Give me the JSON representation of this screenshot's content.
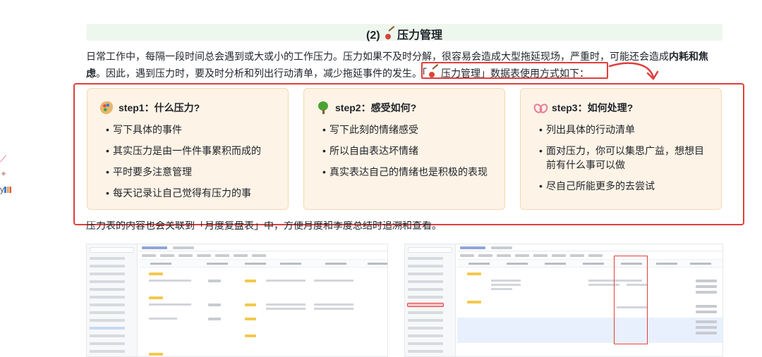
{
  "sidebar_fragment": {
    "items": [
      "",
      "",
      "y"
    ]
  },
  "heading": {
    "prefix": "(2)",
    "title": "压力管理"
  },
  "paragraph": {
    "line1_a": "日常工作中，每隔一段时间总会遇到或大或小的工作压力。压力如果不及时分解，很容易会造成大型拖延现场，严重时，可能还会造成",
    "line1_bold": "内耗和焦",
    "line2_bold": "虑",
    "line2_a": "。因此，遇到压力时，要及时分析和列出行动清单，减少拖延事件的发生。",
    "tag_open": "「",
    "tag_text": "压力管理",
    "tag_close": "」",
    "line2_b": "数据表使用方式如下："
  },
  "cards": [
    {
      "icon": "palette-icon",
      "title": "step1：什么压力?",
      "items": [
        "写下具体的事件",
        "其实压力是由一件件事累积而成的",
        "平时要多注意管理",
        "每天记录让自己觉得有压力的事"
      ]
    },
    {
      "icon": "tree-icon",
      "title": "step2：感受如何?",
      "items": [
        "写下此刻的情绪感受",
        "所以自由表达坏情绪",
        "真实表达自己的情绪也是积极的表现"
      ]
    },
    {
      "icon": "ribbon-icon",
      "title": "step3：如何处理?",
      "items": [
        "列出具体的行动清单",
        "面对压力，你可以集思广益，想想目前有什么事可以做",
        "尽自己所能更多的去尝试"
      ]
    }
  ],
  "caption": "压力表的内容也会关联到「月度复盘表」中，方便月度和季度总结时追溯和查看。",
  "colors": {
    "highlight_red": "#e23d3d",
    "card_bg": "#fdf3e6",
    "heading_bg": "#eef7ee"
  }
}
